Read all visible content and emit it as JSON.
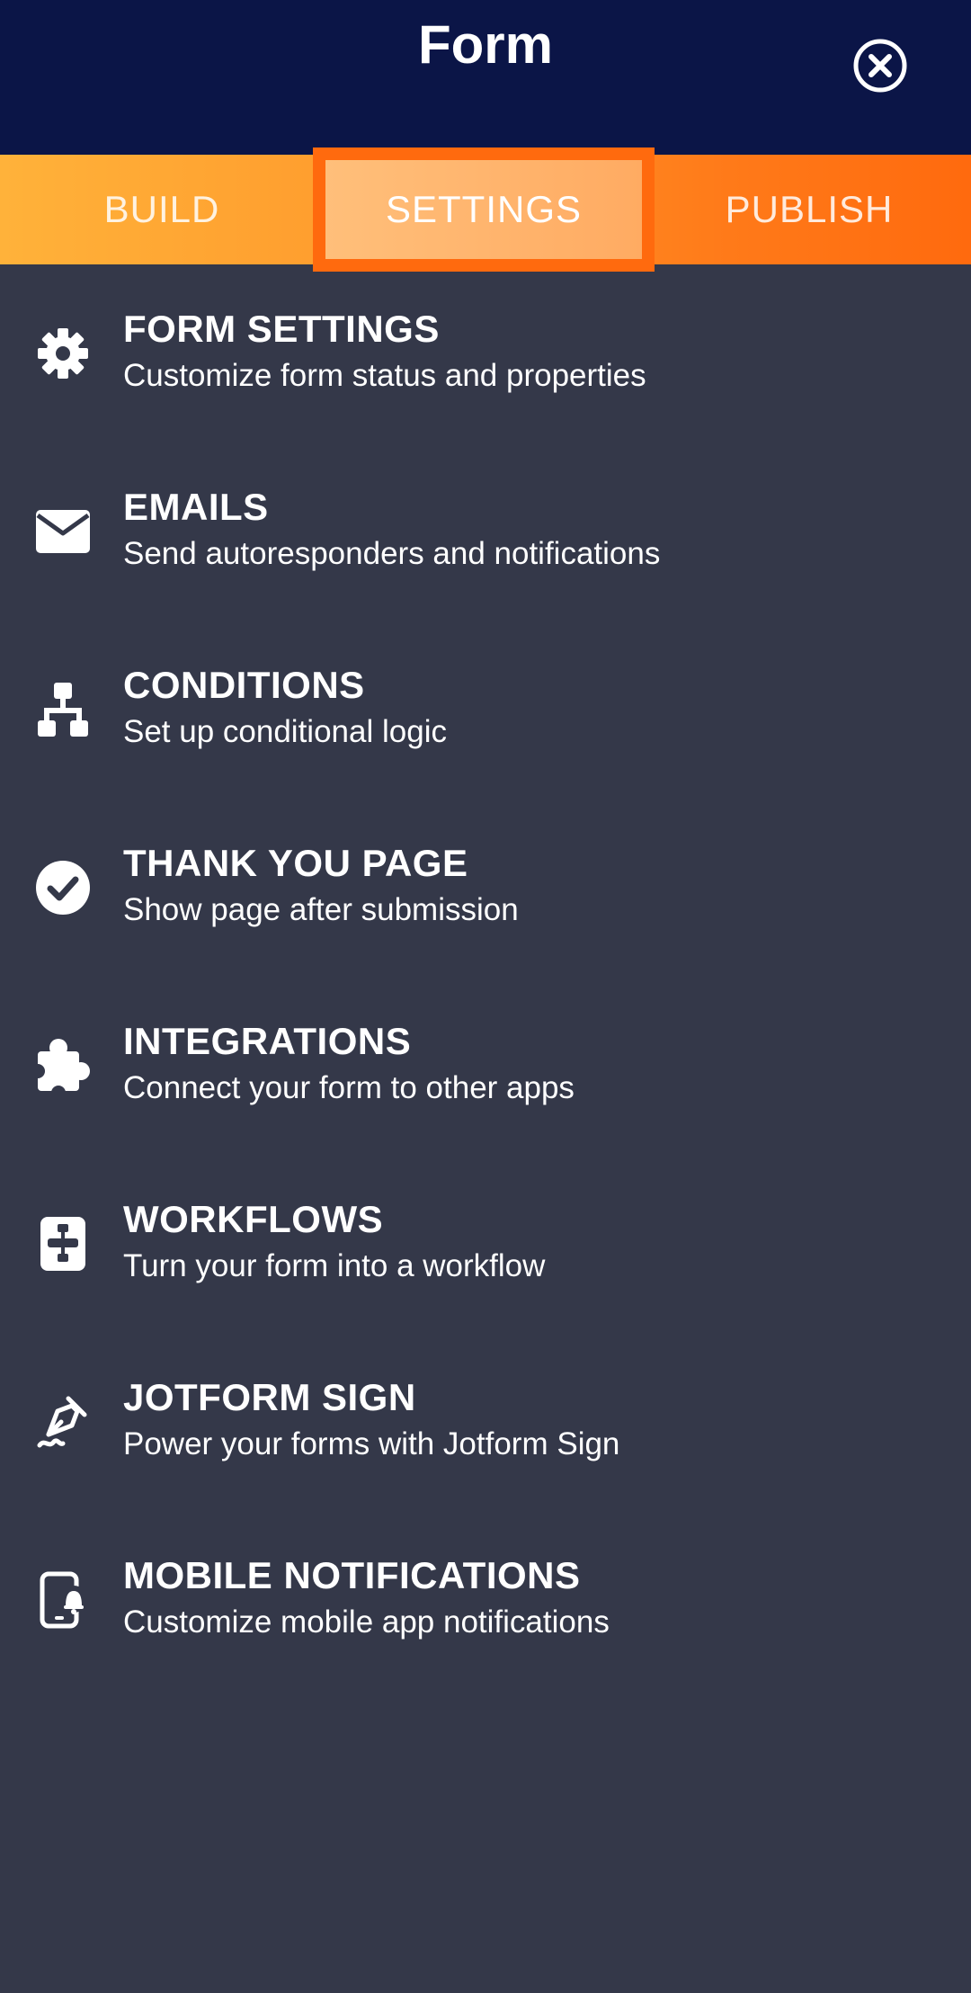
{
  "header": {
    "title": "Form",
    "close_icon": "close-circle-icon"
  },
  "tabs": [
    {
      "label": "BUILD",
      "active": false
    },
    {
      "label": "SETTINGS",
      "active": true
    },
    {
      "label": "PUBLISH",
      "active": false
    }
  ],
  "colors": {
    "header_bg": "#0b1547",
    "tab_gradient_start": "#ffb23a",
    "tab_gradient_end": "#ff6a0e",
    "active_tab_border": "#ff6a0e",
    "panel_bg": "#343849"
  },
  "menu": {
    "items": [
      {
        "icon": "gear-icon",
        "title": "FORM SETTINGS",
        "desc": "Customize form status and properties"
      },
      {
        "icon": "envelope-icon",
        "title": "EMAILS",
        "desc": "Send autoresponders and notifications"
      },
      {
        "icon": "sitemap-icon",
        "title": "CONDITIONS",
        "desc": "Set up conditional logic"
      },
      {
        "icon": "check-circle-icon",
        "title": "THANK YOU PAGE",
        "desc": "Show page after submission"
      },
      {
        "icon": "puzzle-icon",
        "title": "INTEGRATIONS",
        "desc": "Connect your form to other apps"
      },
      {
        "icon": "workflow-icon",
        "title": "WORKFLOWS",
        "desc": "Turn your form into a workflow"
      },
      {
        "icon": "pen-sign-icon",
        "title": "JOTFORM SIGN",
        "desc": "Power your forms with Jotform Sign"
      },
      {
        "icon": "mobile-bell-icon",
        "title": "MOBILE NOTIFICATIONS",
        "desc": "Customize mobile app notifications"
      }
    ]
  }
}
